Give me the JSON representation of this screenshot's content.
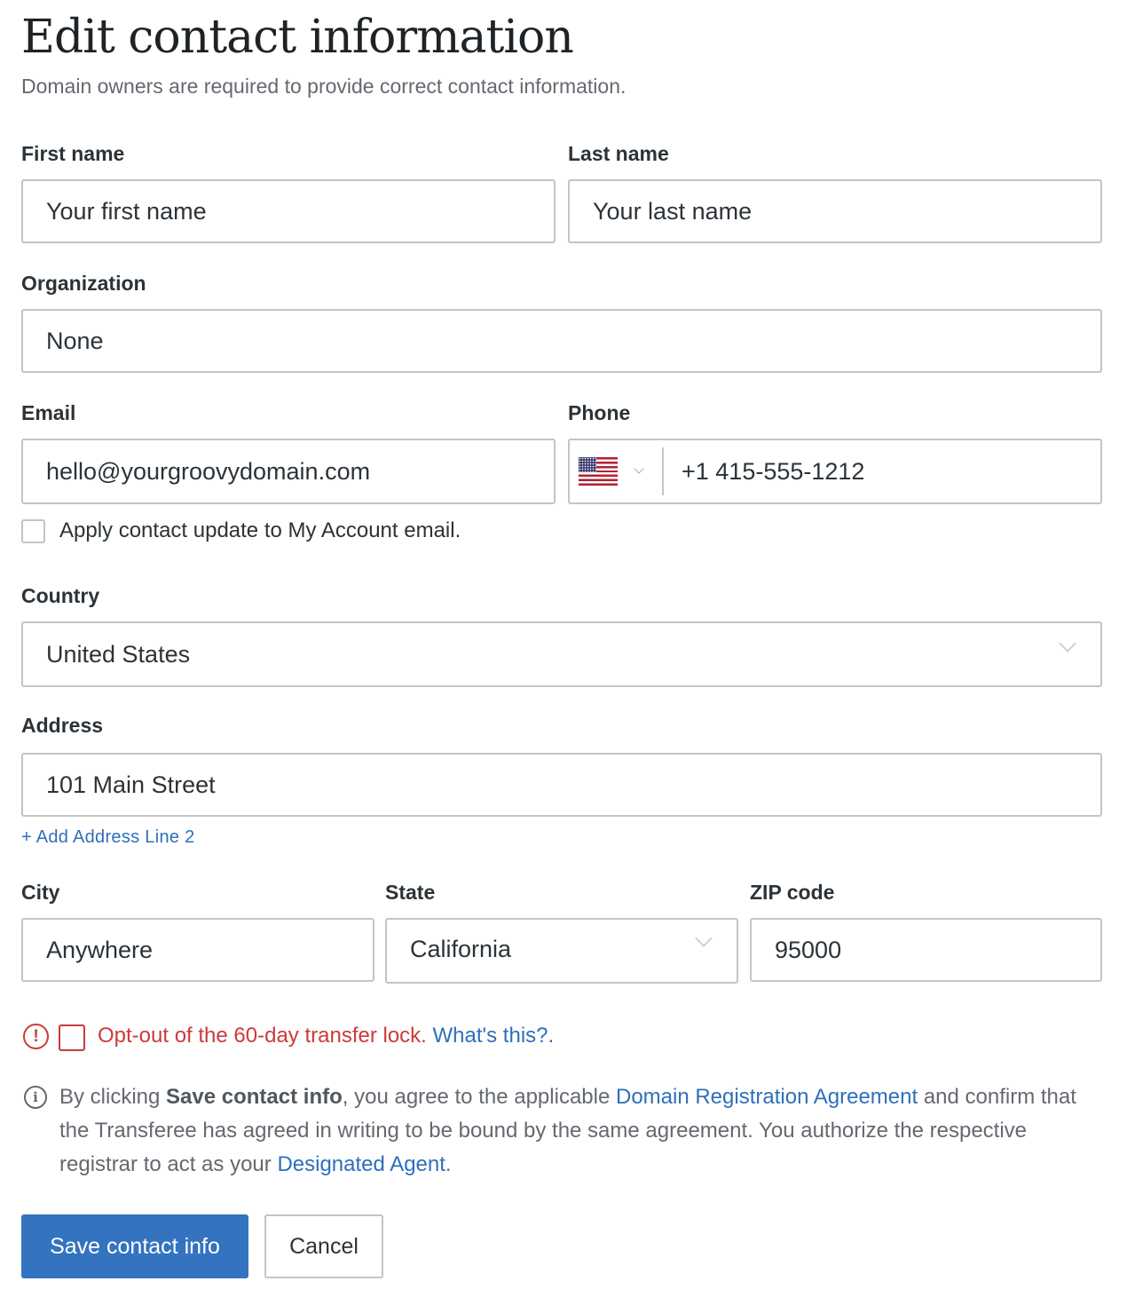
{
  "header": {
    "title": "Edit contact information",
    "subtitle": "Domain owners are required to provide correct contact information."
  },
  "fields": {
    "first_name": {
      "label": "First name",
      "value": "Your first name"
    },
    "last_name": {
      "label": "Last name",
      "value": "Your last name"
    },
    "organization": {
      "label": "Organization",
      "value": "None"
    },
    "email": {
      "label": "Email",
      "value": "hello@yourgroovydomain.com"
    },
    "phone": {
      "label": "Phone",
      "country_flag": "us-flag-icon",
      "value": "+1 415-555-1212"
    },
    "apply_account_email": {
      "label": "Apply contact update to My Account email.",
      "checked": false
    },
    "country": {
      "label": "Country",
      "selected": "United States"
    },
    "address": {
      "label": "Address",
      "value": "101 Main Street",
      "add_line_link": "+ Add Address Line 2"
    },
    "city": {
      "label": "City",
      "value": "Anywhere"
    },
    "state": {
      "label": "State",
      "selected": "California"
    },
    "zip": {
      "label": "ZIP code",
      "value": "95000"
    }
  },
  "transfer_lock": {
    "checked": false,
    "label": "Opt-out of the 60-day transfer lock.",
    "help_link": "What's this?",
    "trailing": "."
  },
  "legal": {
    "part1": "By clicking ",
    "bold": "Save contact info",
    "part2": ", you agree to the applicable ",
    "link1": "Domain Registration Agreement",
    "part3": " and confirm that the Transferee has agreed in writing to be bound by the same agreement. You authorize the respective registrar to act as your ",
    "link2": "Designated Agent",
    "part4": "."
  },
  "actions": {
    "save_label": "Save contact info",
    "cancel_label": "Cancel"
  },
  "colors": {
    "primary": "#3373bf",
    "link": "#2e6fbb",
    "error": "#cc3a3a",
    "border": "#c3c4c7"
  }
}
